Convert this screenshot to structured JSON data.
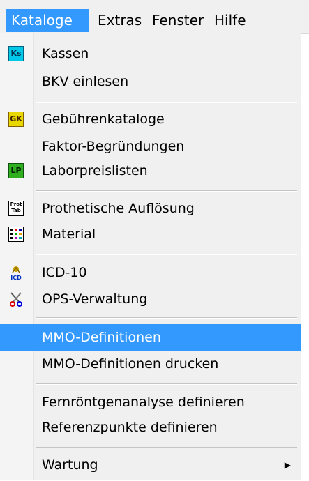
{
  "menubar": {
    "items": [
      "Kataloge",
      "Extras",
      "Fenster",
      "Hilfe"
    ]
  },
  "menu": {
    "kassen": {
      "label": "Kassen",
      "icon": "ks-icon",
      "icon_text": "Ks"
    },
    "bkv": {
      "label": "BKV einlesen"
    },
    "gebuehren": {
      "label": "Gebührenkataloge",
      "icon": "gk-icon",
      "icon_text": "GK"
    },
    "faktor": {
      "label": "Faktor-Begründungen"
    },
    "labor": {
      "label": "Laborpreislisten",
      "icon": "lp-icon",
      "icon_text": "LP"
    },
    "prothetik": {
      "label": "Prothetische Auflösung",
      "icon": "prothetik-table-icon",
      "icon_text": "Prot Tab"
    },
    "material": {
      "label": "Material",
      "icon": "material-grid-icon"
    },
    "icd": {
      "label": "ICD-10",
      "icon": "icd-icon",
      "icon_text": "ICD"
    },
    "ops": {
      "label": "OPS-Verwaltung",
      "icon": "ops-scissors-icon"
    },
    "mmo": {
      "label": "MMO-Definitionen",
      "highlighted": true
    },
    "mmo_print": {
      "label": "MMO-Definitionen drucken"
    },
    "fernroentgen": {
      "label": "Fernröntgenanalyse definieren"
    },
    "referenz": {
      "label": "Referenzpunkte definieren"
    },
    "wartung": {
      "label": "Wartung",
      "submenu": true
    }
  },
  "colors": {
    "highlight": "#3399ff",
    "menu_background": "#f0f0f0"
  }
}
